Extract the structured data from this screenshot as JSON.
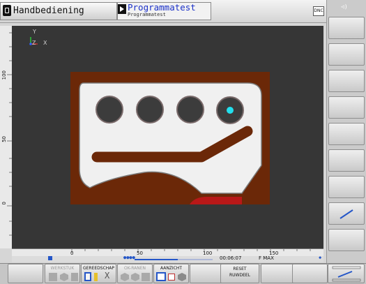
{
  "header": {
    "mode_left": "Handbediening",
    "mode_right": "Programmatest",
    "program_name": "Programmatest",
    "dnc_label": "DNC"
  },
  "graphics": {
    "axis_y": "Y",
    "axis_x": "X",
    "axis_z": "Z",
    "ruler_h_labels": [
      "0",
      "50",
      "100",
      "150"
    ],
    "ruler_v_labels": [
      "100",
      "50",
      "0"
    ],
    "colors": {
      "background": "#363636",
      "stock": "#6b2808",
      "surface": "#f0f0f0",
      "tool": "#22e0ee"
    }
  },
  "status": {
    "time": "00:06:07",
    "feed": "F MAX"
  },
  "bottom_softkeys": [
    {
      "label": "WERKSTUK",
      "enabled": false
    },
    {
      "label": "GEREEDSCHAP",
      "enabled": true
    },
    {
      "label": "OK-RANEN",
      "enabled": false
    },
    {
      "label": "AANZICHT",
      "enabled": true
    },
    {
      "label": "",
      "enabled": true
    },
    {
      "label": "RESET",
      "label2": "RUWDEEL",
      "enabled": true
    },
    {
      "label": "",
      "enabled": true
    },
    {
      "label": "",
      "enabled": true
    },
    {
      "label": "",
      "enabled": true
    }
  ]
}
